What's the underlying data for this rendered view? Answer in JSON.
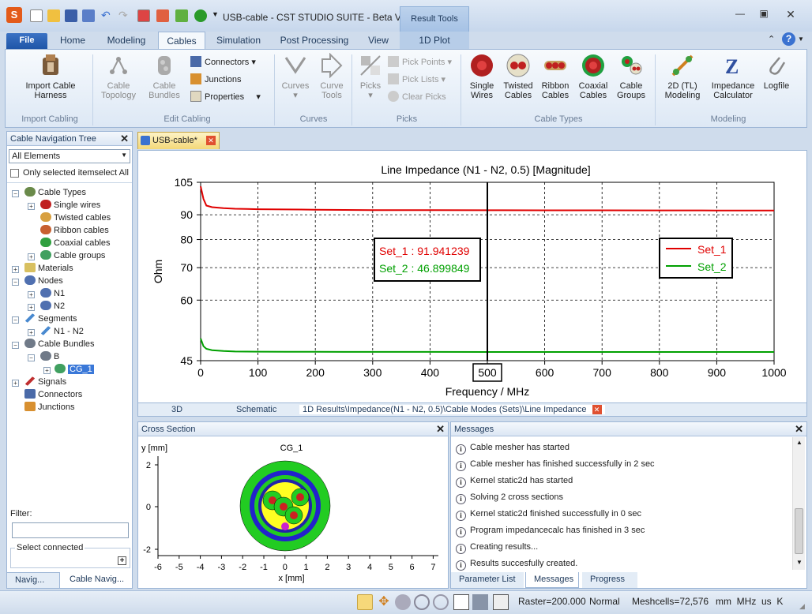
{
  "window": {
    "title": "USB-cable - CST STUDIO SUITE - Beta Versio...",
    "context_tab": "Result Tools"
  },
  "tabs": {
    "file": "File",
    "home": "Home",
    "modeling": "Modeling",
    "cables": "Cables",
    "simulation": "Simulation",
    "post": "Post Processing",
    "view": "View",
    "plot1d": "1D Plot"
  },
  "ribbon": {
    "import_cable_harness": "Import Cable Harness",
    "cable_topology": "Cable Topology",
    "cable_bundles": "Cable Bundles",
    "connectors": "Connectors",
    "junctions": "Junctions",
    "properties": "Properties",
    "curves": "Curves",
    "curve_tools": "Curve Tools",
    "picks": "Picks",
    "pick_points": "Pick Points",
    "pick_lists": "Pick Lists",
    "clear_picks": "Clear Picks",
    "single_wires": "Single Wires",
    "twisted_cables": "Twisted Cables",
    "ribbon_cables": "Ribbon Cables",
    "coaxial_cables": "Coaxial Cables",
    "cable_groups": "Cable Groups",
    "tl_modeling": "2D (TL) Modeling",
    "impedance_calc": "Impedance Calculator",
    "logfile": "Logfile",
    "groups": {
      "import_cabling": "Import Cabling",
      "edit_cabling": "Edit Cabling",
      "curves": "Curves",
      "picks": "Picks",
      "cable_types": "Cable Types",
      "modeling": "Modeling"
    }
  },
  "nav": {
    "title": "Cable Navigation Tree",
    "filter_select": "All Elements",
    "only_selected": "Only selected items",
    "select_all": "elect All",
    "tree": [
      "Cable Types",
      "Single wires",
      "Twisted cables",
      "Ribbon cables",
      "Coaxial cables",
      "Cable groups",
      "Materials",
      "Nodes",
      "N1",
      "N2",
      "Segments",
      "N1 - N2",
      "Cable Bundles",
      "B",
      "CG_1",
      "Signals",
      "Connectors",
      "Junctions"
    ],
    "filter_label": "Filter:",
    "select_connected": "Select connected",
    "tab_navig": "Navig...",
    "tab_cable_navig": "Cable Navig..."
  },
  "doc_tab": "USB-cable*",
  "view_tabs": {
    "t3d": "3D",
    "schematic": "Schematic",
    "results": "1D Results\\Impedance(N1 - N2, 0.5)\\Cable Modes (Sets)\\Line Impedance"
  },
  "chart_data": {
    "type": "line",
    "title": "Line Impedance (N1 - N2, 0.5) [Magnitude]",
    "xlabel": "Frequency / MHz",
    "ylabel": "Ohm",
    "xlim": [
      0,
      1000
    ],
    "ylim": [
      45,
      105
    ],
    "y_scale": "log",
    "xticks": [
      0,
      100,
      200,
      300,
      400,
      500,
      600,
      700,
      800,
      900,
      1000
    ],
    "yticks": [
      45,
      60,
      70,
      80,
      90,
      105
    ],
    "grid": true,
    "legend_position": "top-right",
    "marker_x": 500,
    "marker_x_label": "500",
    "marker_values": {
      "set1": "Set_1 : 91.941239",
      "set2": "Set_2 : 46.899849"
    },
    "series": [
      {
        "name": "Set_1",
        "color": "#e00000",
        "x": [
          0,
          5,
          10,
          20,
          40,
          60,
          80,
          100,
          150,
          200,
          250,
          300,
          400,
          500,
          600,
          700,
          800,
          900,
          1000
        ],
        "y": [
          103,
          97,
          94,
          93.3,
          92.9,
          92.6,
          92.5,
          92.4,
          92.3,
          92.2,
          92.1,
          92.0,
          91.98,
          91.94,
          91.92,
          91.9,
          91.88,
          91.86,
          91.85
        ]
      },
      {
        "name": "Set_2",
        "color": "#00a000",
        "x": [
          0,
          5,
          10,
          20,
          40,
          60,
          80,
          100,
          150,
          200,
          250,
          300,
          400,
          500,
          600,
          700,
          800,
          900,
          1000
        ],
        "y": [
          50,
          48.2,
          47.6,
          47.3,
          47.1,
          47.0,
          46.98,
          46.96,
          46.94,
          46.93,
          46.92,
          46.91,
          46.905,
          46.9,
          46.898,
          46.896,
          46.895,
          46.894,
          46.893
        ]
      }
    ]
  },
  "cross_section": {
    "title": "Cross Section",
    "plot_title": "CG_1",
    "ylabel": "y [mm]",
    "xlabel": "x [mm]",
    "xticks": [
      "-6",
      "-5",
      "-4",
      "-3",
      "-2",
      "-1",
      "0",
      "1",
      "2",
      "3",
      "4",
      "5",
      "6",
      "7"
    ],
    "yticks": [
      "2",
      "0",
      "-2"
    ]
  },
  "messages": {
    "title": "Messages",
    "items": [
      "Cable mesher has started",
      "Cable mesher has finished successfully in 2 sec",
      "Kernel static2d has started",
      "Solving 2 cross sections",
      "Kernel static2d finished successfully in 0 sec",
      "Program impedancecalc has finished in 3 sec",
      "Creating results...",
      "Results succesfully created."
    ],
    "tab_params": "Parameter List",
    "tab_messages": "Messages",
    "tab_progress": "Progress"
  },
  "status": {
    "raster": "Raster=200.000",
    "mode": "Normal",
    "meshcells": "Meshcells=72,576",
    "units": "mm  MHz  us  K"
  }
}
